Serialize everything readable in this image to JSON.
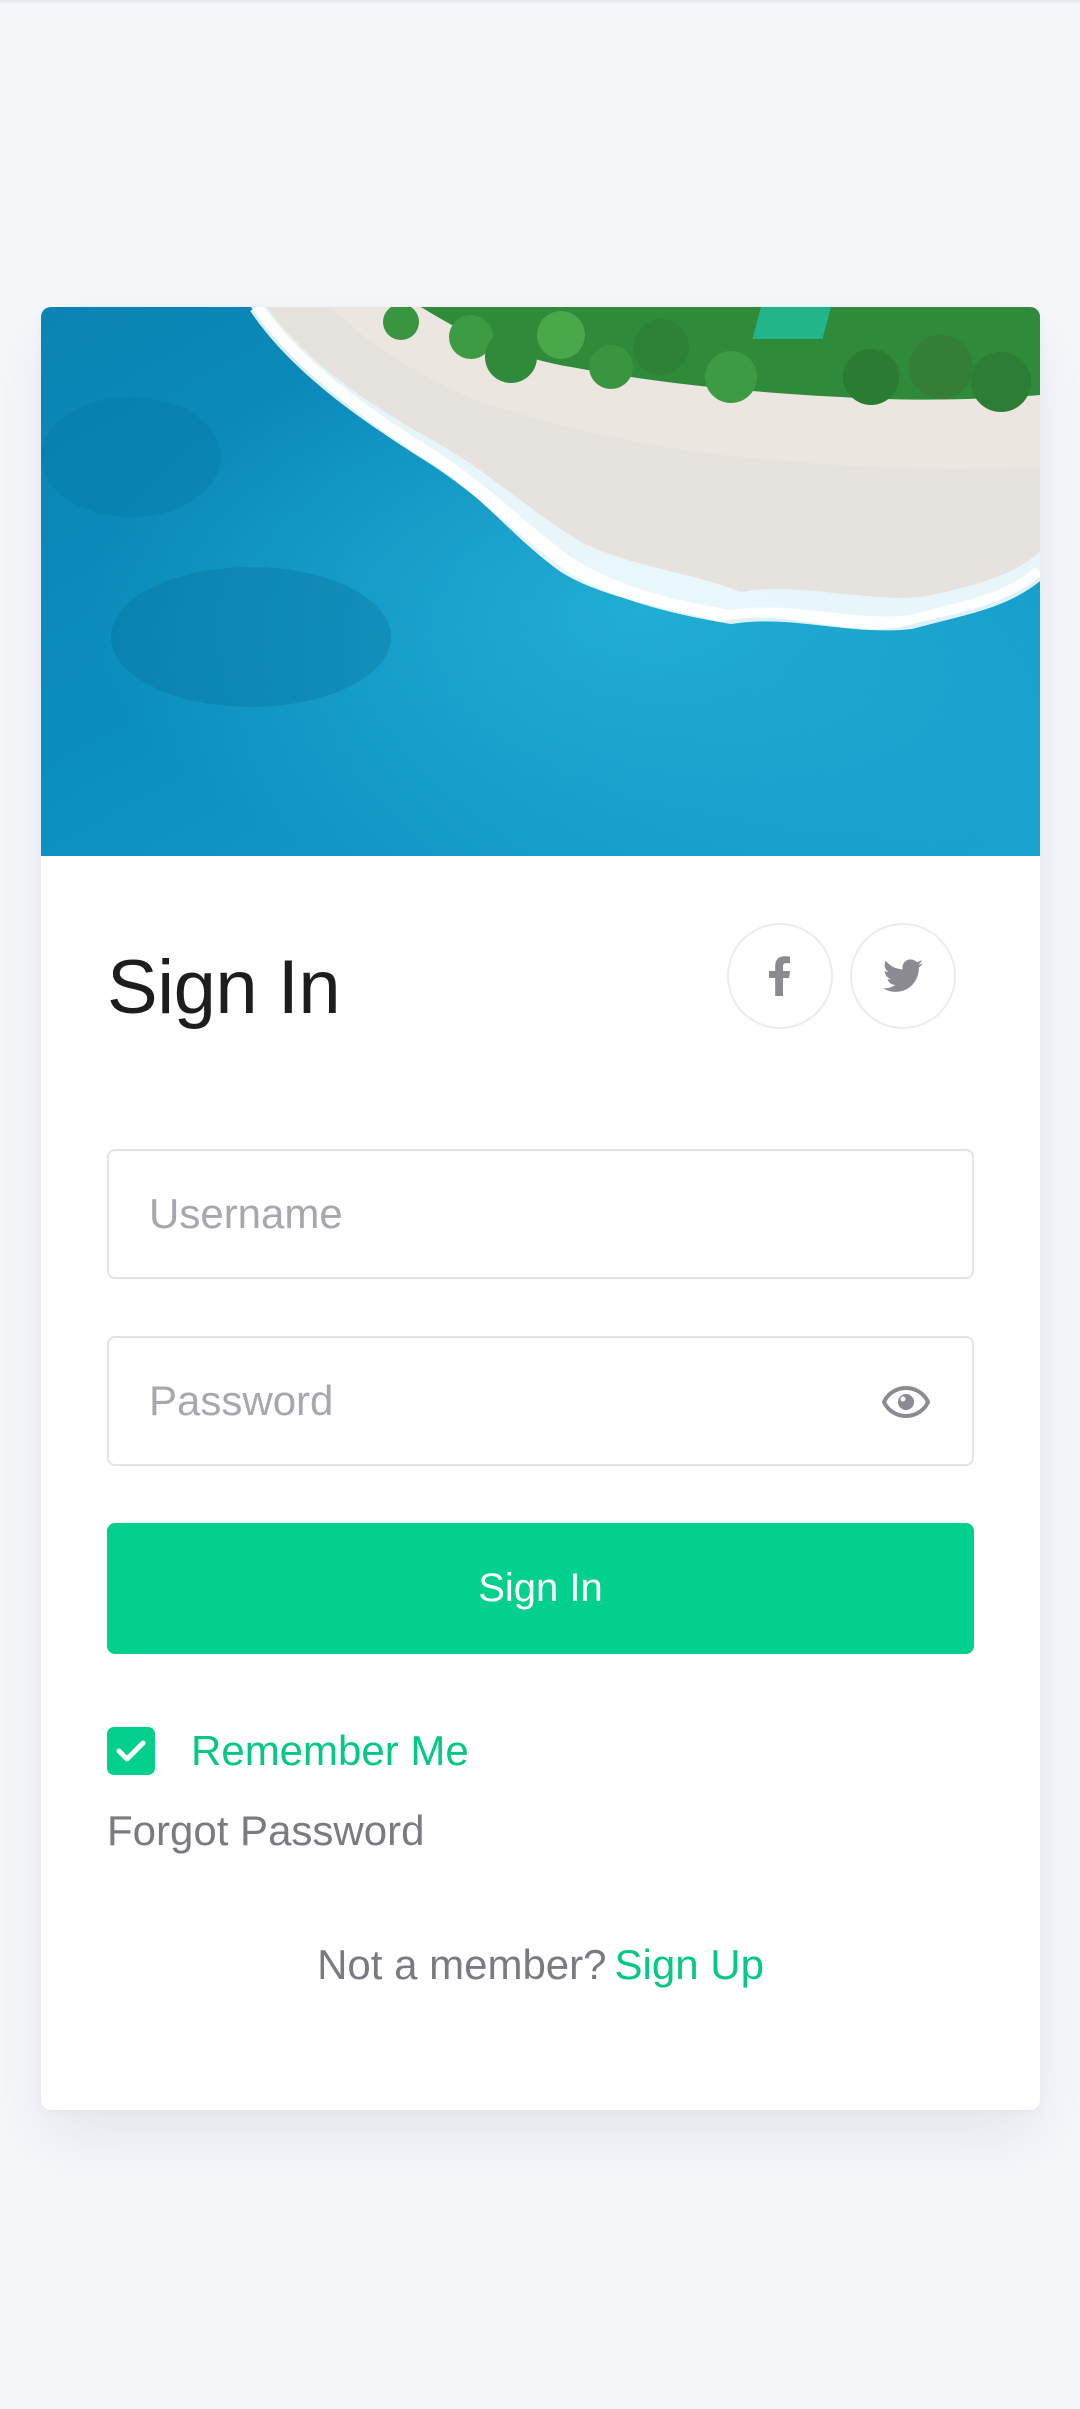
{
  "login": {
    "title": "Sign In",
    "username_placeholder": "Username",
    "password_placeholder": "Password",
    "signin_button": "Sign In",
    "remember_label": "Remember Me",
    "remember_checked": true,
    "forgot_label": "Forgot Password",
    "signup_prompt": "Not a member?",
    "signup_link": "Sign Up"
  },
  "social": {
    "facebook_icon": "facebook-icon",
    "twitter_icon": "twitter-icon"
  },
  "colors": {
    "accent": "#03d08c",
    "background": "#f6f7fb",
    "card": "#ffffff"
  }
}
